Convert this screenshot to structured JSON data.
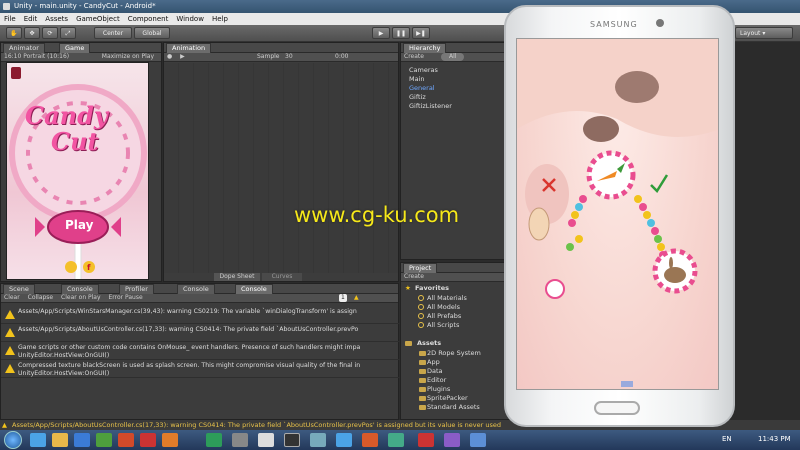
{
  "window": {
    "title": "Unity - main.unity - CandyCut - Android*"
  },
  "menu": [
    "File",
    "Edit",
    "Assets",
    "GameObject",
    "Component",
    "Window",
    "Help"
  ],
  "toolbar": {
    "pivot": "Center",
    "space": "Global",
    "layout": "Layout"
  },
  "left_tabs": {
    "animator": "Animator",
    "game": "Game"
  },
  "game_toolbar": {
    "resolution": "16:10 Portrait (10:16)",
    "maximize": "Maximize on Play"
  },
  "game_logo": {
    "line1": "Candy",
    "line2": "Cut",
    "play": "Play"
  },
  "animation": {
    "tab": "Animation",
    "sample_label": "Sample",
    "sample_value": "30",
    "time": "0:00",
    "dope": "Dope Sheet",
    "curves": "Curves"
  },
  "hierarchy": {
    "tab": "Hierarchy",
    "create": "Create",
    "search": "All",
    "items": [
      "Cameras",
      "Main",
      "General",
      "Giftiz",
      "GiftizListener"
    ]
  },
  "bottom_tabs": [
    "Scene",
    "Console",
    "Profiler",
    "Console",
    "Console"
  ],
  "console": {
    "buttons": [
      "Clear",
      "Collapse",
      "Clear on Play",
      "Error Pause"
    ],
    "count": "1",
    "lines": [
      {
        "l1": "Assets/App/Scripts/WinStarsManager.cs(39,43): warning CS0219: The variable `winDialogTransform' is assign",
        "l2": ""
      },
      {
        "l1": "Assets/App/Scripts/AboutUsController.cs(17,33): warning CS0414: The private field `AboutUsController.prevPo",
        "l2": ""
      },
      {
        "l1": "Game scripts or other custom code contains OnMouse_ event handlers. Presence of such handlers might impa",
        "l2": "UnityEditor.HostView:OnGUI()"
      },
      {
        "l1": "Compressed texture blackScreen is used as splash screen. This might compromise visual quality of the final in",
        "l2": "UnityEditor.HostView:OnGUI()"
      }
    ]
  },
  "project": {
    "tab": "Project",
    "create": "Create",
    "favorites_label": "Favorites",
    "favorites": [
      "All Materials",
      "All Models",
      "All Prefabs",
      "All Scripts"
    ],
    "assets_label": "Assets",
    "assets": [
      "2D Rope System",
      "App",
      "Data",
      "Editor",
      "Plugins",
      "SpritePacker",
      "Standard Assets"
    ]
  },
  "status_bar": "Assets/App/Scripts/AboutUsController.cs(17,33): warning CS0414: The private field `AboutUsController.prevPos' is assigned but its value is never used",
  "phone": {
    "brand": "SAMSUNG"
  },
  "watermark": "www.cg-ku.com",
  "taskbar": {
    "lang": "EN",
    "time": "11:43 PM"
  },
  "colors": {
    "unity_dark": "#3c3c3c",
    "warning": "#f2c31b",
    "candy_pink": "#e0408a",
    "taskbar": "#23385a"
  }
}
